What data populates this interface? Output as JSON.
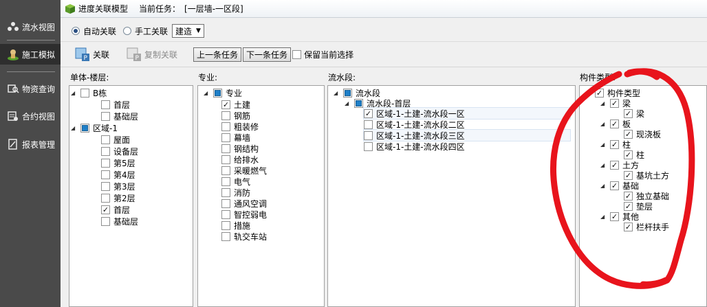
{
  "sidebar": {
    "items": [
      {
        "label": "流水视图",
        "icon": "flow-view-icon"
      },
      {
        "label": "施工模拟",
        "icon": "construction-sim-icon"
      },
      {
        "label": "物资查询",
        "icon": "material-query-icon"
      },
      {
        "label": "合约视图",
        "icon": "contract-view-icon"
      },
      {
        "label": "报表管理",
        "icon": "report-icon"
      }
    ]
  },
  "header": {
    "title": "进度关联模型",
    "task_label": "当前任务：",
    "task_value": "[一层墙-一区段]"
  },
  "mode": {
    "auto": "自动关联",
    "manual": "手工关联",
    "discipline_select": "建造"
  },
  "toolbar": {
    "link": "关联",
    "copy_link": "复制关联",
    "prev_task": "上一条任务",
    "next_task": "下一条任务",
    "keep_selection": "保留当前选择"
  },
  "panels": {
    "floors_label": "单体-楼层:",
    "major_label": "专业:",
    "segment_label": "流水段:",
    "component_label": "构件类型:"
  },
  "floors": {
    "group1": "B栋",
    "group1_items": [
      "首层",
      "基础层"
    ],
    "group2": "区域-1",
    "group2_items": [
      "屋面",
      "设备层",
      "第5层",
      "第4层",
      "第3层",
      "第2层",
      "首层",
      "基础层"
    ]
  },
  "majors": {
    "root": "专业",
    "items": [
      "土建",
      "钢筋",
      "粗装修",
      "幕墙",
      "钢结构",
      "给排水",
      "采暖燃气",
      "电气",
      "消防",
      "通风空调",
      "智控弱电",
      "措施",
      "轨交车站"
    ]
  },
  "segments": {
    "root": "流水段",
    "child": "流水段-首层",
    "items": [
      "区域-1-土建-流水段一区",
      "区域-1-土建-流水段二区",
      "区域-1-土建-流水段三区",
      "区域-1-土建-流水段四区"
    ]
  },
  "components": {
    "root": "构件类型",
    "beam": "梁",
    "beam_item": "梁",
    "slab": "板",
    "slab_item": "现浇板",
    "column": "柱",
    "column_item": "柱",
    "earth": "土方",
    "earth_item": "基坑土方",
    "foundation": "基础",
    "foundation_item1": "独立基础",
    "foundation_item2": "垫层",
    "other": "其他",
    "other_item": "栏杆扶手"
  },
  "colors": {
    "sidebar_bg": "#4a4a4a",
    "annotation_red": "#e8141c"
  }
}
